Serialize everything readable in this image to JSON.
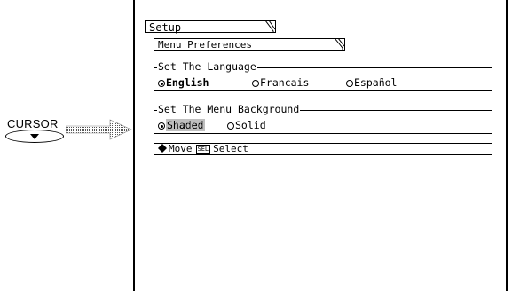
{
  "cursor": {
    "label": "CURSOR",
    "key_icon": "triangle-down-icon"
  },
  "menu": {
    "title": "Setup",
    "submenu_title": "Menu Preferences"
  },
  "language": {
    "title": "Set The Language",
    "options": [
      "English",
      "Francais",
      "Español"
    ],
    "selected": "English"
  },
  "background": {
    "title": "Set The Menu Background",
    "options": [
      "Shaded",
      "Solid"
    ],
    "selected": "Shaded"
  },
  "status_bar": {
    "move_icon": "diamond-arrows-icon",
    "move_label": "Move",
    "select_key": "SEL",
    "select_label": "Select"
  }
}
